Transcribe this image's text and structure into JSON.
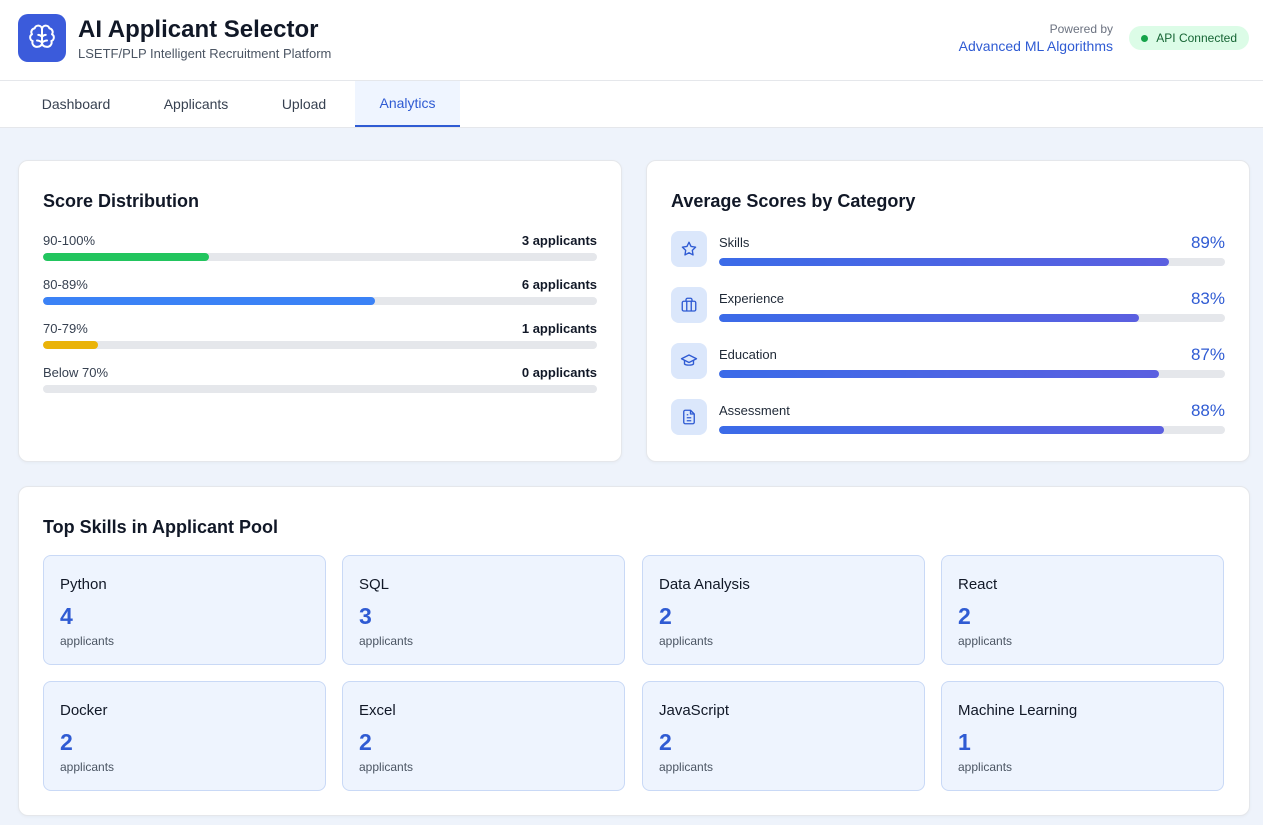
{
  "app": {
    "title": "AI Applicant Selector",
    "subtitle": "LSETF/PLP Intelligent Recruitment Platform",
    "icon": "brain-icon",
    "powered_label": "Powered by",
    "powered_value": "Advanced ML Algorithms",
    "api_status": "API Connected"
  },
  "tabs": [
    {
      "label": "Dashboard",
      "active": false
    },
    {
      "label": "Applicants",
      "active": false
    },
    {
      "label": "Upload",
      "active": false
    },
    {
      "label": "Analytics",
      "active": true
    }
  ],
  "score_distribution": {
    "title": "Score Distribution",
    "rows": [
      {
        "range": "90-100%",
        "count": "3 applicants",
        "fraction": 0.3,
        "color": "#22c55e"
      },
      {
        "range": "80-89%",
        "count": "6 applicants",
        "fraction": 0.6,
        "color": "#3b82f6"
      },
      {
        "range": "70-79%",
        "count": "1 applicants",
        "fraction": 0.1,
        "color": "#eab308"
      },
      {
        "range": "Below 70%",
        "count": "0 applicants",
        "fraction": 0.0,
        "color": "#9ca3af"
      }
    ]
  },
  "category_scores": {
    "title": "Average Scores by Category",
    "rows": [
      {
        "label": "Skills",
        "value": "89%",
        "fraction": 0.89,
        "icon": "star-icon"
      },
      {
        "label": "Experience",
        "value": "83%",
        "fraction": 0.83,
        "icon": "briefcase-icon"
      },
      {
        "label": "Education",
        "value": "87%",
        "fraction": 0.87,
        "icon": "graduation-cap-icon"
      },
      {
        "label": "Assessment",
        "value": "88%",
        "fraction": 0.88,
        "icon": "document-icon"
      }
    ]
  },
  "top_skills": {
    "title": "Top Skills in Applicant Pool",
    "unit": "applicants",
    "items": [
      {
        "name": "Python",
        "count": "4"
      },
      {
        "name": "SQL",
        "count": "3"
      },
      {
        "name": "Data Analysis",
        "count": "2"
      },
      {
        "name": "React",
        "count": "2"
      },
      {
        "name": "Docker",
        "count": "2"
      },
      {
        "name": "Excel",
        "count": "2"
      },
      {
        "name": "JavaScript",
        "count": "2"
      },
      {
        "name": "Machine Learning",
        "count": "1"
      }
    ]
  }
}
